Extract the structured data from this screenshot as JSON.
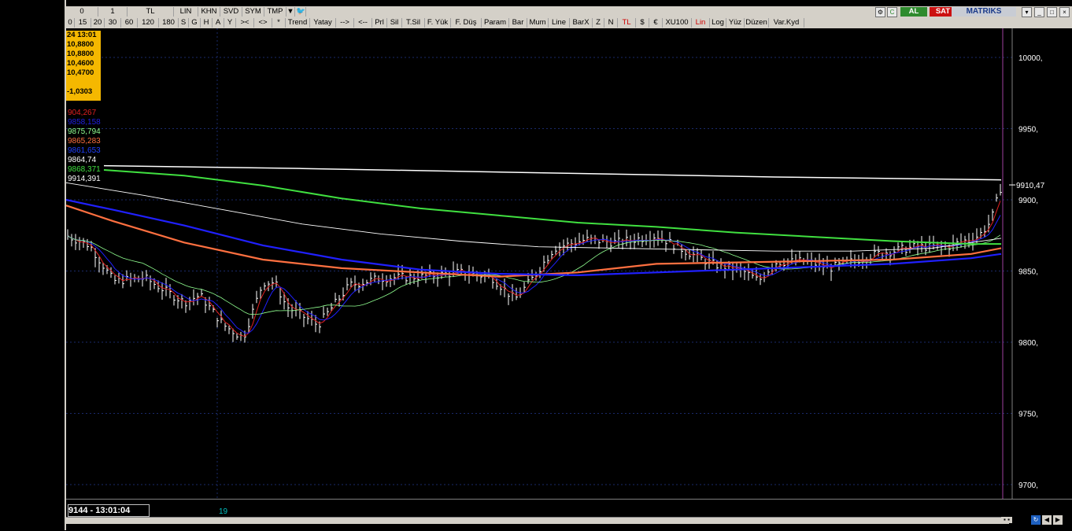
{
  "toolbar1": {
    "items": [
      "0",
      "1",
      "TL",
      "LIN",
      "KHN",
      "SVD",
      "SYM",
      "TMP"
    ],
    "al_label": "AL",
    "sat_label": "SAT",
    "brand": "MATRIKS"
  },
  "toolbar2": {
    "items": [
      "0",
      "15",
      "20",
      "30",
      "60",
      "120",
      "180",
      "S",
      "G",
      "H",
      "A",
      "Y",
      "><",
      "<>",
      "*",
      "Trend",
      "Yatay",
      "-->",
      "<--",
      "Prl",
      "Sil",
      "T.Sil",
      "F. Yük",
      "F. Düş",
      "Param",
      "Bar",
      "Mum",
      "Line",
      "BarX",
      "Z",
      "N",
      "TL",
      "$",
      "€",
      "XU100",
      "Lin",
      "Log",
      "Yüz",
      "Düzen",
      "Var.Kyd"
    ],
    "red_items": [
      "TL",
      "Lin"
    ]
  },
  "infobox": {
    "lines": [
      "24 13:01",
      "10,8800",
      "10,8800",
      "10,4600",
      "10,4700",
      "",
      "-1,0303"
    ]
  },
  "legend": [
    {
      "text": "904,267",
      "color": "#e02020"
    },
    {
      "text": "9858,158",
      "color": "#2020e0"
    },
    {
      "text": "9875,794",
      "color": "#90ff90"
    },
    {
      "text": "9865,283",
      "color": "#ff7040"
    },
    {
      "text": "9861,653",
      "color": "#2040ff"
    },
    {
      "text": "9864,74",
      "color": "#ffffff"
    },
    {
      "text": "9868,371",
      "color": "#40e040"
    },
    {
      "text": "9914,391",
      "color": "#ffffff"
    }
  ],
  "axis": {
    "ticks": [
      "10000,",
      "9950,",
      "9900,",
      "9850,",
      "9800,",
      "9750,",
      "9700,"
    ],
    "last_price": "9910,47"
  },
  "status": {
    "time_label": "9144 - 13:01:04",
    "day_label": "19"
  },
  "colors": {
    "bar": "#ffffff",
    "ma_red": "#e02020",
    "ma_blue": "#2020ff",
    "ma_lightgreen": "#90ff90",
    "ma_orange": "#ff7040",
    "ma_green": "#40e040",
    "ma_white": "#ffffff",
    "grid": "#1a2a6a"
  }
}
